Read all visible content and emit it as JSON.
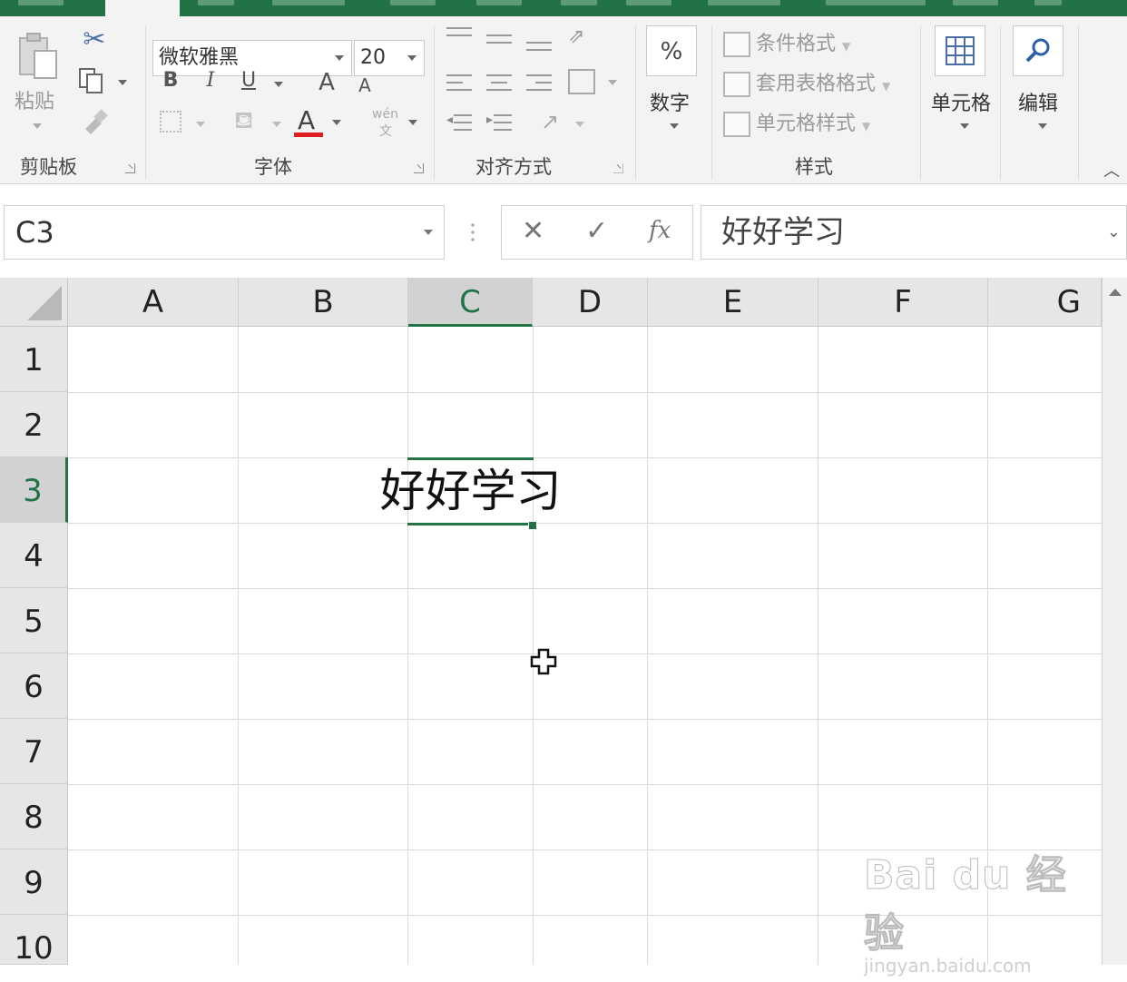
{
  "ribbon": {
    "clipboard": {
      "paste_label": "粘贴",
      "group_label": "剪贴板"
    },
    "font": {
      "family": "微软雅黑",
      "size": "20",
      "bold": "B",
      "italic": "I",
      "underline": "U",
      "grow": "A",
      "shrink": "A",
      "font_color_glyph": "A",
      "phonetic_top": "wén",
      "phonetic_bottom": "文",
      "group_label": "字体"
    },
    "alignment": {
      "group_label": "对齐方式"
    },
    "number": {
      "percent": "%",
      "label": "数字"
    },
    "styles": {
      "conditional_format": "条件格式",
      "table_format": "套用表格格式",
      "cell_styles": "单元格样式",
      "group_label": "样式"
    },
    "cells": {
      "label": "单元格"
    },
    "editing": {
      "label": "编辑"
    }
  },
  "formula_bar": {
    "name_box": "C3",
    "cancel": "✕",
    "confirm": "✓",
    "fx": "fx",
    "content": "好好学习"
  },
  "grid": {
    "columns": [
      "A",
      "B",
      "C",
      "D",
      "E",
      "F",
      "G"
    ],
    "rows": [
      "1",
      "2",
      "3",
      "4",
      "5",
      "6",
      "7",
      "8",
      "9",
      "10"
    ],
    "active_cell": "C3",
    "cell_value": "好好学习"
  },
  "watermark": {
    "main": "Bai du 经验",
    "sub": "jingyan.baidu.com"
  },
  "colors": {
    "accent": "#217346",
    "font_color": "#e02020"
  }
}
